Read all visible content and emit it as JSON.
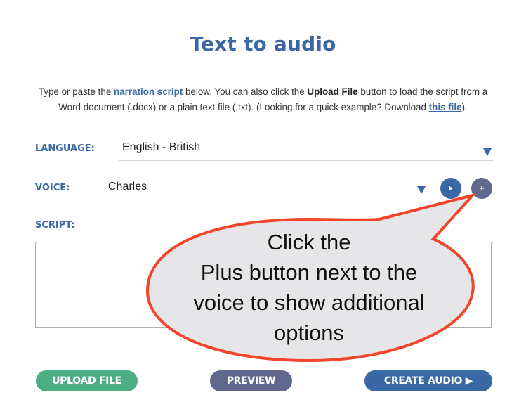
{
  "header": {
    "title": "Text to audio"
  },
  "intro": {
    "text_1": "Type or paste the ",
    "link_narration": "narration script",
    "text_2": " below. You can also click the ",
    "bold_upload": "Upload File",
    "text_3": " button to load the script from a Word document (.docx) or a plain text file (.txt). (Looking for a quick example? Download ",
    "link_file": "this file",
    "text_4": ")."
  },
  "form": {
    "language_label": "LANGUAGE:",
    "language_value": "English - British",
    "voice_label": "VOICE:",
    "voice_value": "Charles",
    "script_label": "SCRIPT:",
    "script_value": "",
    "play_icon": "play-icon",
    "plus_icon": "plus-icon"
  },
  "buttons": {
    "upload": "UPLOAD FILE",
    "preview": "PREVIEW",
    "create": "CREATE AUDIO ▶"
  },
  "callout": {
    "line1": "Click the",
    "line2": "Plus button next to the",
    "line3": "voice to show additional",
    "line4": "options"
  },
  "colors": {
    "brand_blue": "#3a68a4",
    "upload_green": "#4caf84",
    "preview_slate": "#61688e",
    "callout_border": "#f2462c",
    "callout_fill": "#e6e6e8"
  }
}
